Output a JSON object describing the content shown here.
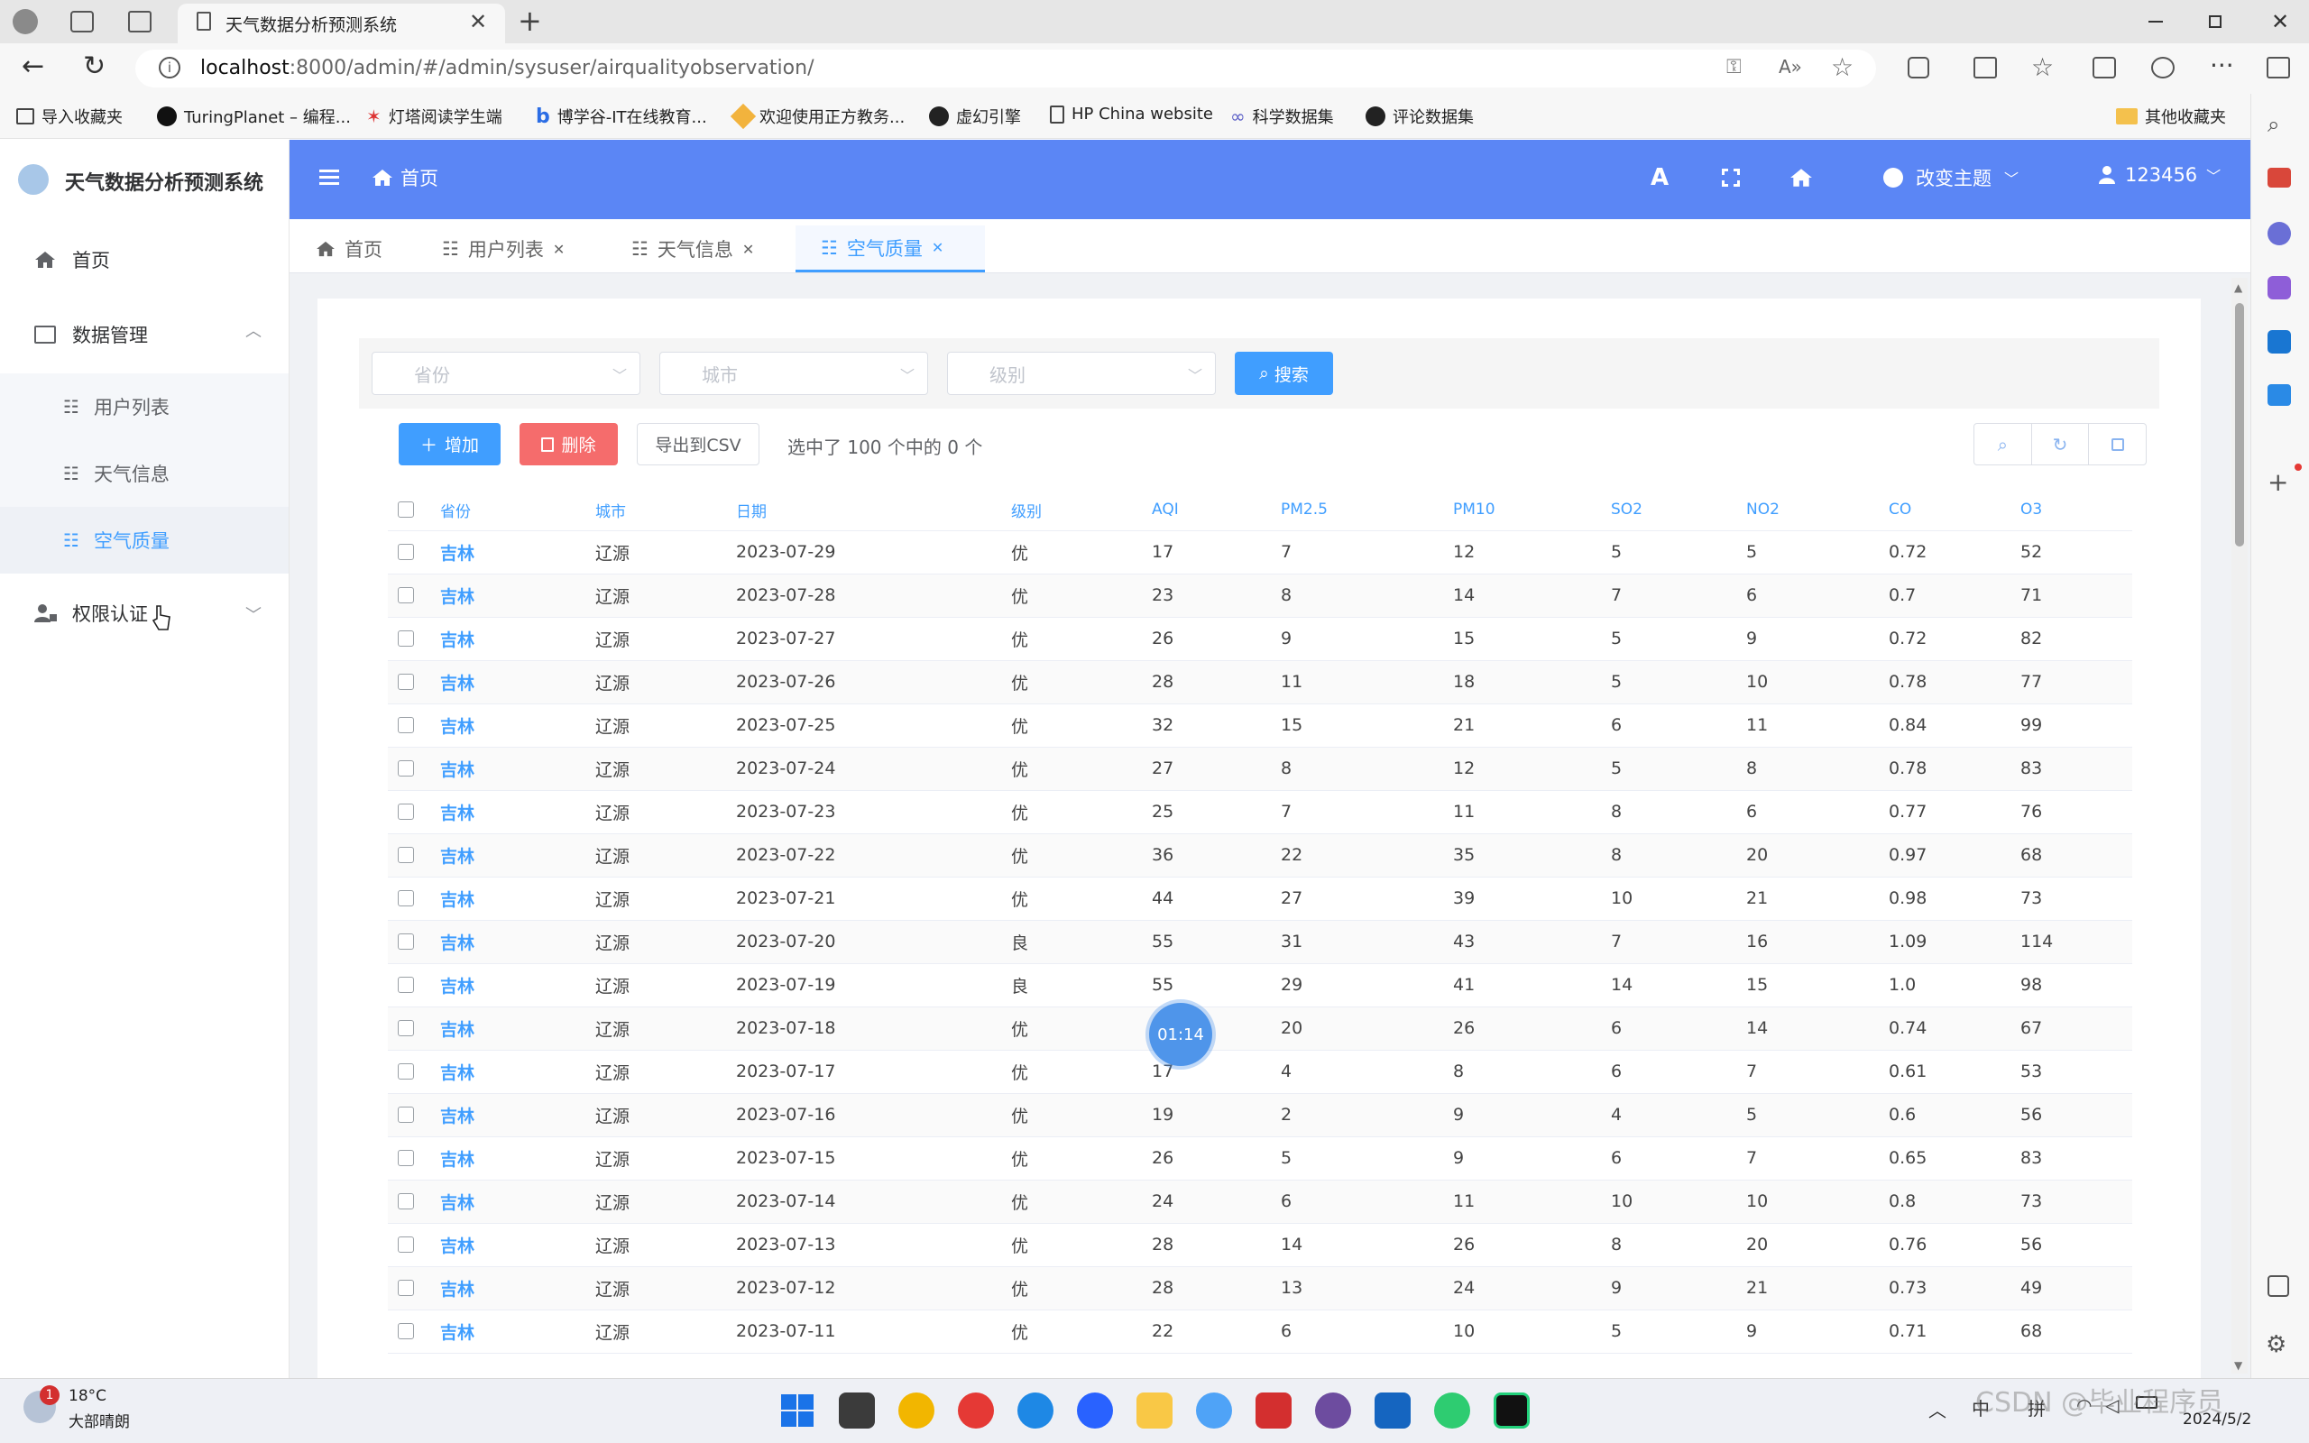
{
  "browser": {
    "tab_title": "天气数据分析预测系统",
    "url_host": "localhost",
    "url_rest": ":8000/admin/#/admin/sysuser/airqualityobservation/",
    "bookmarks": [
      "导入收藏夹",
      "TuringPlanet – 编程...",
      "灯塔阅读学生端",
      "博学谷-IT在线教育...",
      "欢迎使用正方教务...",
      "虚幻引擎",
      "HP China website",
      "科学数据集",
      "评论数据集"
    ],
    "other_bookmarks": "其他收藏夹"
  },
  "app": {
    "title": "天气数据分析预测系统",
    "home_label": "首页",
    "theme_label": "改变主题",
    "user_label": "123456"
  },
  "sidebar": {
    "home": "首页",
    "data_mgmt": "数据管理",
    "sub_items": [
      "用户列表",
      "天气信息",
      "空气质量"
    ],
    "auth": "权限认证"
  },
  "page_tabs": [
    "首页",
    "用户列表",
    "天气信息",
    "空气质量"
  ],
  "filters": {
    "province_placeholder": "省份",
    "city_placeholder": "城市",
    "level_placeholder": "级别",
    "search_label": "搜索"
  },
  "toolbar": {
    "add_label": "增加",
    "delete_label": "删除",
    "export_label": "导出到CSV",
    "selection_text": "选中了 100 个中的 0 个"
  },
  "table": {
    "headers": [
      "省份",
      "城市",
      "日期",
      "级别",
      "AQI",
      "PM2.5",
      "PM10",
      "SO2",
      "NO2",
      "CO",
      "O3"
    ],
    "rows": [
      [
        "吉林",
        "辽源",
        "2023-07-29",
        "优",
        "17",
        "7",
        "12",
        "5",
        "5",
        "0.72",
        "52"
      ],
      [
        "吉林",
        "辽源",
        "2023-07-28",
        "优",
        "23",
        "8",
        "14",
        "7",
        "6",
        "0.7",
        "71"
      ],
      [
        "吉林",
        "辽源",
        "2023-07-27",
        "优",
        "26",
        "9",
        "15",
        "5",
        "9",
        "0.72",
        "82"
      ],
      [
        "吉林",
        "辽源",
        "2023-07-26",
        "优",
        "28",
        "11",
        "18",
        "5",
        "10",
        "0.78",
        "77"
      ],
      [
        "吉林",
        "辽源",
        "2023-07-25",
        "优",
        "32",
        "15",
        "21",
        "6",
        "11",
        "0.84",
        "99"
      ],
      [
        "吉林",
        "辽源",
        "2023-07-24",
        "优",
        "27",
        "8",
        "12",
        "5",
        "8",
        "0.78",
        "83"
      ],
      [
        "吉林",
        "辽源",
        "2023-07-23",
        "优",
        "25",
        "7",
        "11",
        "8",
        "6",
        "0.77",
        "76"
      ],
      [
        "吉林",
        "辽源",
        "2023-07-22",
        "优",
        "36",
        "22",
        "35",
        "8",
        "20",
        "0.97",
        "68"
      ],
      [
        "吉林",
        "辽源",
        "2023-07-21",
        "优",
        "44",
        "27",
        "39",
        "10",
        "21",
        "0.98",
        "73"
      ],
      [
        "吉林",
        "辽源",
        "2023-07-20",
        "良",
        "55",
        "31",
        "43",
        "7",
        "16",
        "1.09",
        "114"
      ],
      [
        "吉林",
        "辽源",
        "2023-07-19",
        "良",
        "55",
        "29",
        "41",
        "14",
        "15",
        "1.0",
        "98"
      ],
      [
        "吉林",
        "辽源",
        "2023-07-18",
        "优",
        "",
        "20",
        "26",
        "6",
        "14",
        "0.74",
        "67"
      ],
      [
        "吉林",
        "辽源",
        "2023-07-17",
        "优",
        "17",
        "4",
        "8",
        "6",
        "7",
        "0.61",
        "53"
      ],
      [
        "吉林",
        "辽源",
        "2023-07-16",
        "优",
        "19",
        "2",
        "9",
        "4",
        "5",
        "0.6",
        "56"
      ],
      [
        "吉林",
        "辽源",
        "2023-07-15",
        "优",
        "26",
        "5",
        "9",
        "6",
        "7",
        "0.65",
        "83"
      ],
      [
        "吉林",
        "辽源",
        "2023-07-14",
        "优",
        "24",
        "6",
        "11",
        "10",
        "10",
        "0.8",
        "73"
      ],
      [
        "吉林",
        "辽源",
        "2023-07-13",
        "优",
        "28",
        "14",
        "26",
        "8",
        "20",
        "0.76",
        "56"
      ],
      [
        "吉林",
        "辽源",
        "2023-07-12",
        "优",
        "28",
        "13",
        "24",
        "9",
        "21",
        "0.73",
        "49"
      ],
      [
        "吉林",
        "辽源",
        "2023-07-11",
        "优",
        "22",
        "6",
        "10",
        "5",
        "9",
        "0.71",
        "68"
      ]
    ]
  },
  "overlay": {
    "timer": "01:14"
  },
  "taskbar": {
    "temp": "18°C",
    "weather": "大部晴朗",
    "notif_count": "1",
    "ime1": "中",
    "ime2": "拼",
    "date": "2024/5/2",
    "watermark": "CSDN @毕业程序员"
  },
  "colors": {
    "accent": "#5b86f5",
    "link": "#409eff",
    "danger": "#f56c6c"
  }
}
